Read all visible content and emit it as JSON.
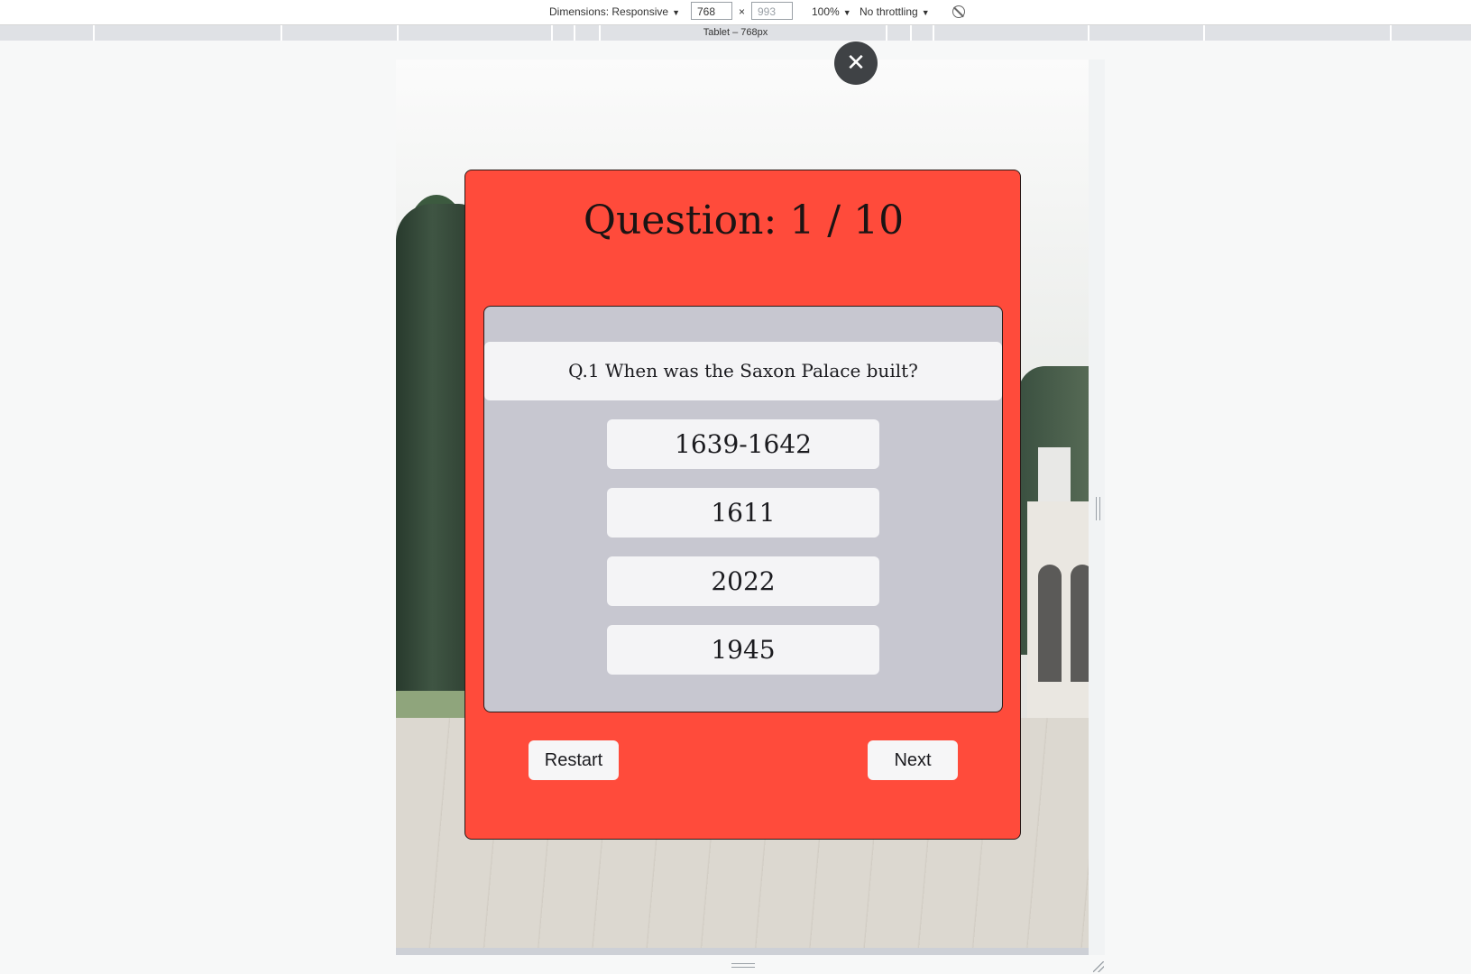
{
  "devtools": {
    "dimensions_label": "Dimensions: Responsive",
    "width_value": "768",
    "times_sign": "×",
    "height_placeholder": "993",
    "zoom": "100%",
    "throttling": "No throttling",
    "media_query_label": "Tablet – 768px"
  },
  "close_symbol": "✕",
  "quiz": {
    "title": "Question: 1 / 10",
    "question": "Q.1 When was the Saxon Palace built?",
    "answers": [
      "1639-1642",
      "1611",
      "2022",
      "1945"
    ],
    "restart_label": "Restart",
    "next_label": "Next"
  },
  "colors": {
    "card": "#ff4b3b",
    "question_panel": "#c7c7d0",
    "button": "#f4f4f6"
  }
}
